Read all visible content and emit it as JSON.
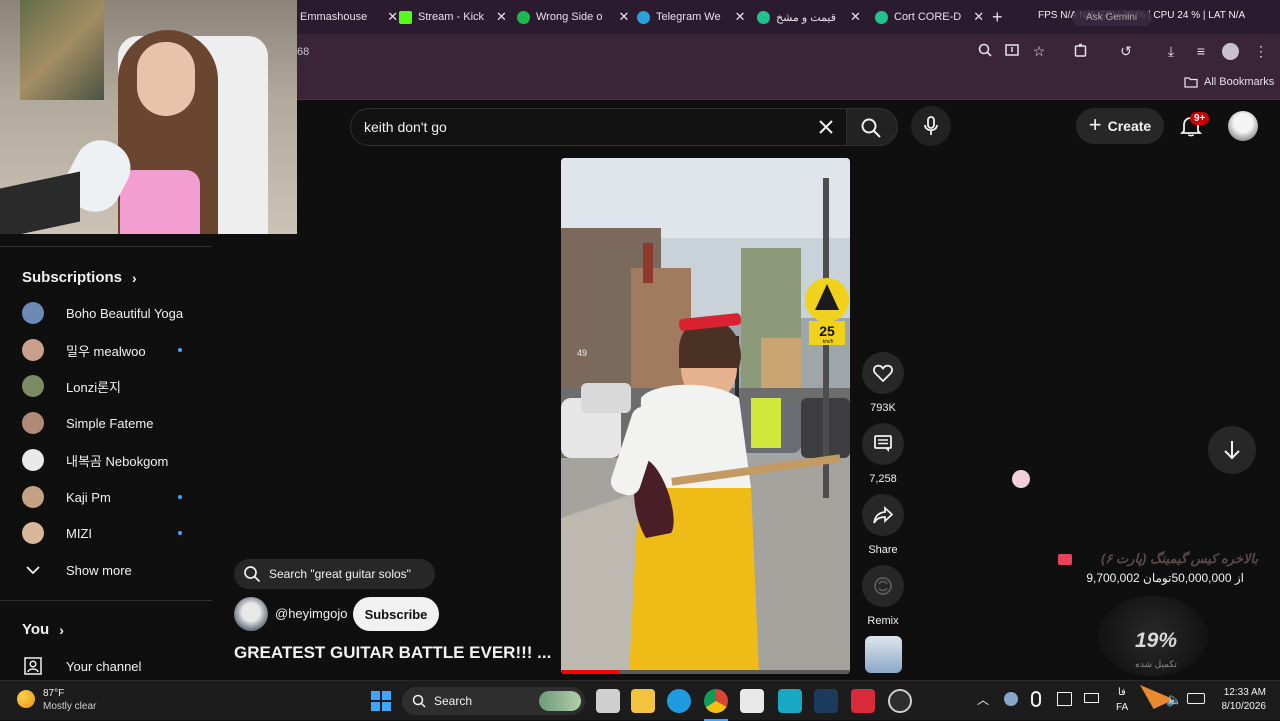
{
  "browser": {
    "tabs": [
      {
        "label": "Emmashouse",
        "color": "#7c5cff"
      },
      {
        "label": "Stream - Kick",
        "color": "#53fc18"
      },
      {
        "label": "Wrong Side o",
        "color": "#1db954"
      },
      {
        "label": "Telegram We",
        "color": "#2aa1da"
      },
      {
        "label": "قیمت و مشخ",
        "color": "#21c28e"
      },
      {
        "label": "Cort CORE-D",
        "color": "#21c28e"
      }
    ],
    "new_tab": "+",
    "address_fragment": "68",
    "bookmarks_label": "All Bookmarks",
    "overlay_stats": "FPS  N/A  N/A  GPU 30 %  |  CPU 24 %  |  LAT  N/A",
    "ask_gemini": "Ask Gemini"
  },
  "search": {
    "query": "keith don't go",
    "create_label": "Create",
    "notifications_badge": "9+"
  },
  "sidebar": {
    "subscriptions_title": "Subscriptions",
    "items": [
      {
        "label": "Boho Beautiful Yoga",
        "new": false,
        "color": "#6b8bb6"
      },
      {
        "label": "밀우 mealwoo",
        "new": true,
        "color": "#c9a08c"
      },
      {
        "label": "Lonzi론지",
        "new": false,
        "color": "#7a8b64"
      },
      {
        "label": "Simple Fateme",
        "new": false,
        "color": "#b08a78"
      },
      {
        "label": "내복곰 Nebokgom",
        "new": false,
        "color": "#e9e9e9"
      },
      {
        "label": "Kaji Pm",
        "new": true,
        "color": "#c3a184"
      },
      {
        "label": "MIZI",
        "new": true,
        "color": "#d8b79b"
      }
    ],
    "show_more": "Show more",
    "you_title": "You",
    "your_channel": "Your channel"
  },
  "short": {
    "search_suggestion": "Search \"great guitar solos\"",
    "channel": "@heyimgojo",
    "subscribe_label": "Subscribe",
    "title": "GREATEST GUITAR BATTLE EVER!!! ...",
    "likes": "793K",
    "comments": "7,258",
    "share": "Share",
    "remix": "Remix",
    "speed_sign": "25",
    "speed_unit": "km/h",
    "house_number": "49"
  },
  "donation": {
    "title": "بالاخره کیس گیمینگ (پارت ۶)",
    "amount": "9,700,002 از 50,000,000تومان",
    "percent": "19%",
    "percent_caption": "تکمیل شده"
  },
  "taskbar": {
    "weather_temp": "87°F",
    "weather_desc": "Mostly clear",
    "search_label": "Search",
    "lang_top": "فا",
    "lang_bottom": "FA",
    "time": "12:33 AM",
    "date": "8/10/2026"
  }
}
